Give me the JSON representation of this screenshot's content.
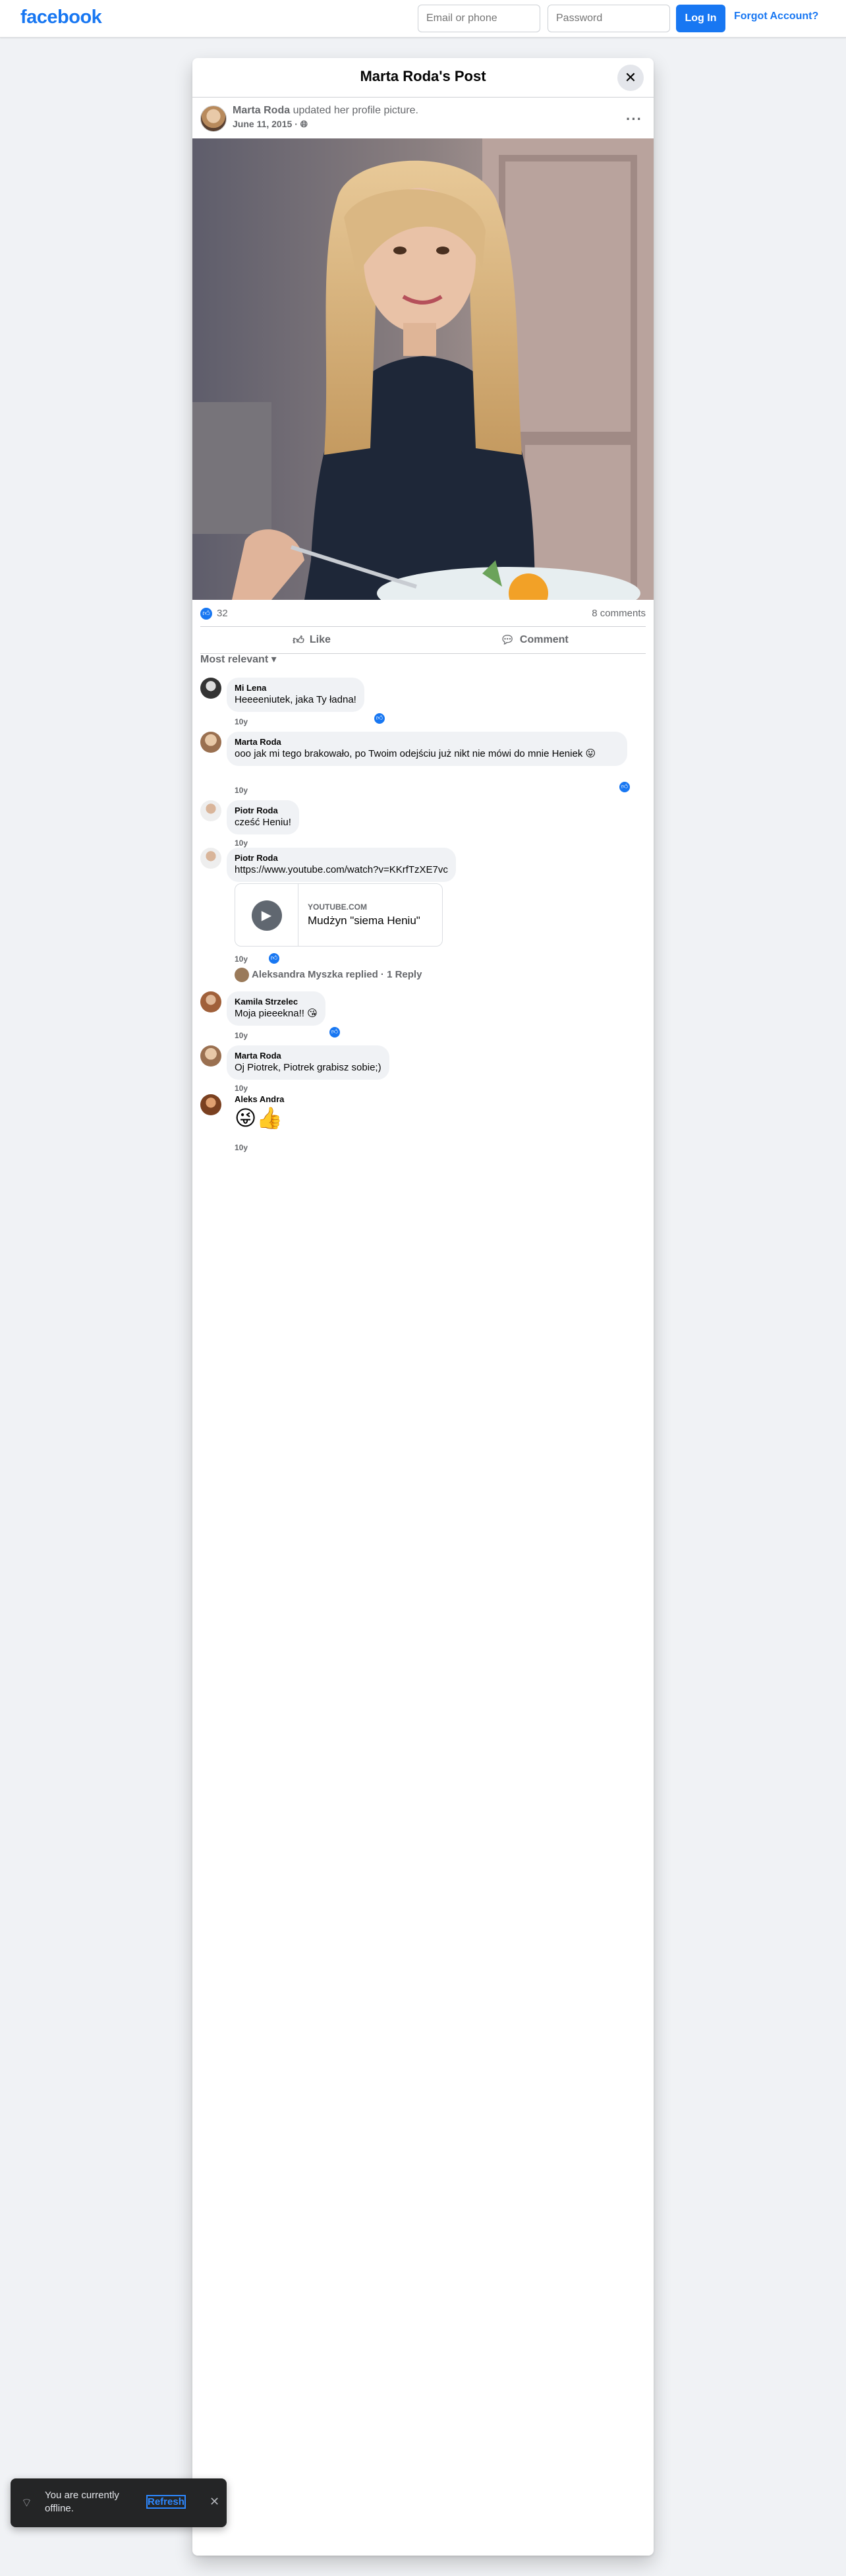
{
  "topbar": {
    "logo": "facebook",
    "email_placeholder": "Email or phone",
    "password_placeholder": "Password",
    "login_label": "Log In",
    "forgot_label": "Forgot Account?"
  },
  "dialog": {
    "title": "Marta Roda's Post",
    "close_icon": "close-icon"
  },
  "post": {
    "author": "Marta Roda",
    "action": "updated her profile picture.",
    "date": "June 11, 2015",
    "privacy_icon": "globe-icon",
    "like_count": "32",
    "comment_count": "8 comments"
  },
  "actions": {
    "like_label": "Like",
    "comment_label": "Comment"
  },
  "sort_label": "Most relevant",
  "comments": [
    {
      "name": "Mi Lena",
      "text": "Heeeeniutek, jaka Ty ładna!",
      "time": "10y"
    },
    {
      "name": "Marta Roda",
      "text": "ooo jak mi tego brakowało, po Twoim odejściu już nikt nie mówi do mnie Heniek 😛",
      "time": "10y"
    },
    {
      "name": "Piotr Roda",
      "text": "cześć Heniu!",
      "time": "10y"
    },
    {
      "name": "Piotr Roda",
      "text": "https://www.youtube.com/watch?v=KKrfTzXE7vc",
      "time": "10y"
    },
    {
      "name": "Kamila Strzelec",
      "text": "Moja pieeekna!! 😘",
      "time": "10y"
    },
    {
      "name": "Marta Roda",
      "text": "Oj Piotrek, Piotrek grabisz sobie;)",
      "time": "10y"
    },
    {
      "name": "Aleks Andra",
      "text": "😜👍",
      "time": "10y"
    }
  ],
  "link_preview": {
    "domain": "YOUTUBE.COM",
    "title": "Mudżyn \"siema Heniu\""
  },
  "replies_label": "Aleksandra Myszka replied · 1 Reply",
  "toast": {
    "text": "You are currently offline.",
    "refresh_label": "Refresh"
  }
}
